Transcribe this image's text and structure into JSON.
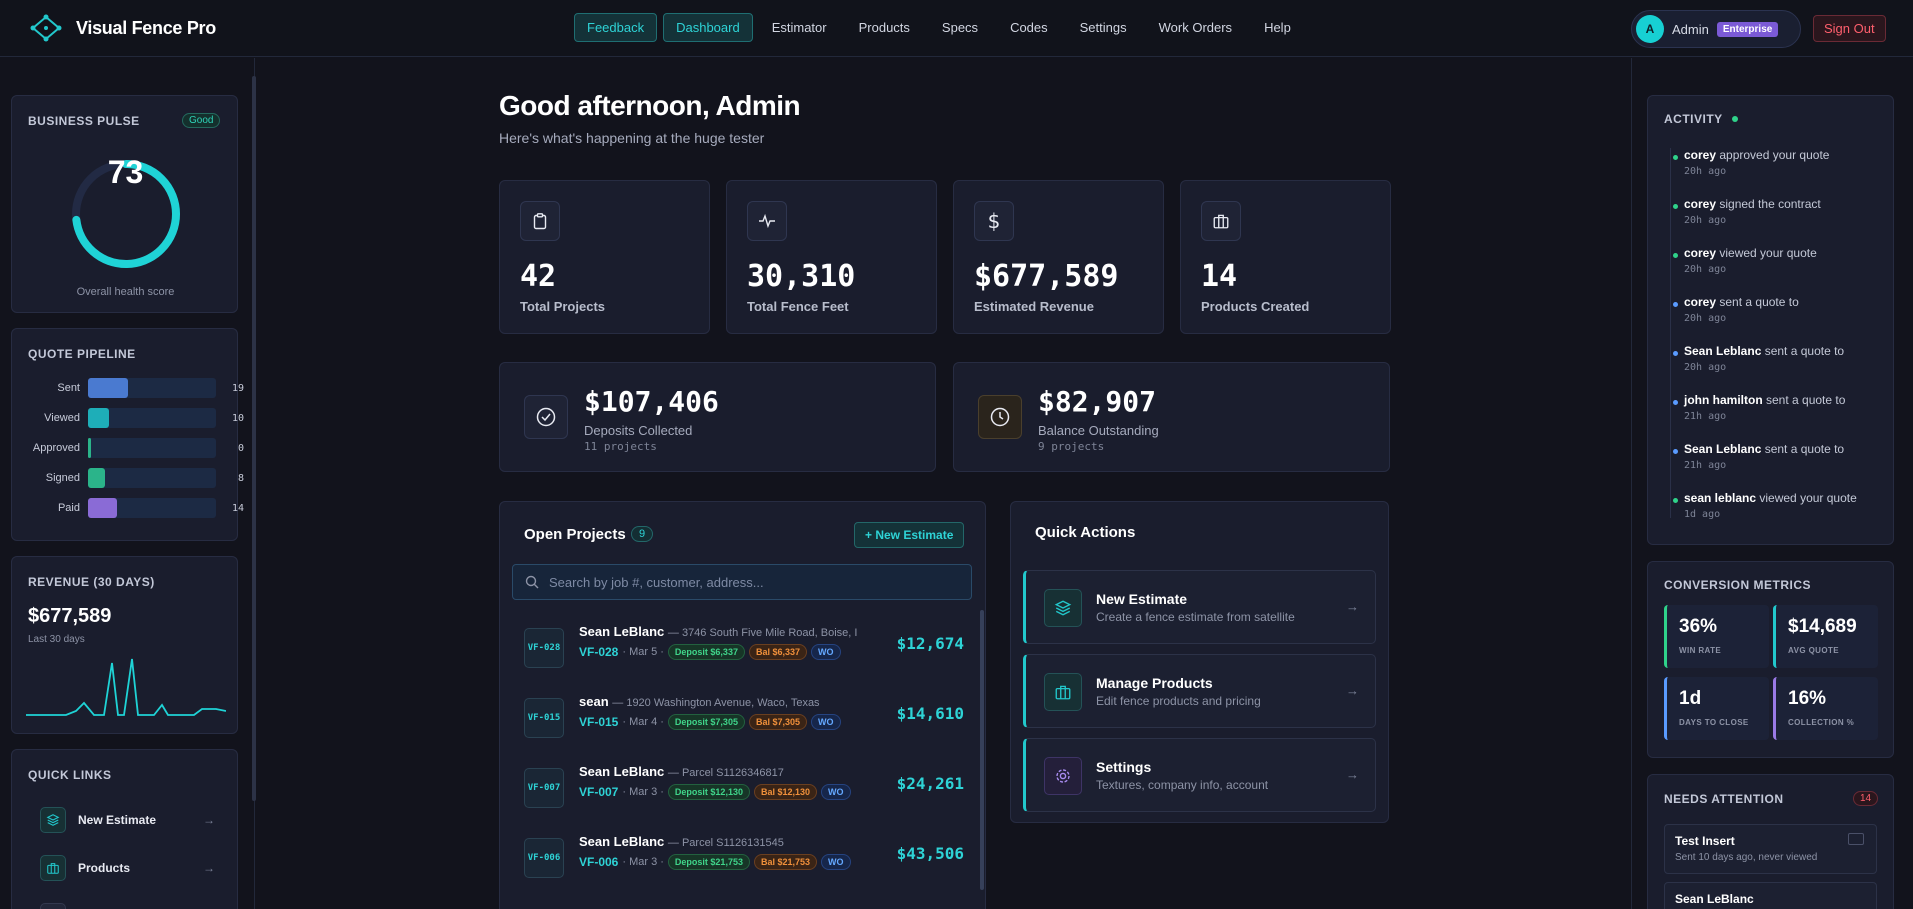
{
  "app": {
    "name": "Visual Fence Pro"
  },
  "nav": {
    "items": [
      "Feedback",
      "Dashboard",
      "Estimator",
      "Products",
      "Specs",
      "Codes",
      "Settings",
      "Work Orders",
      "Help"
    ]
  },
  "user": {
    "initial": "A",
    "name": "Admin",
    "plan": "Enterprise",
    "signout": "Sign Out"
  },
  "business_pulse": {
    "title": "BUSINESS PULSE",
    "status": "Good",
    "score": 73,
    "score_text": "73",
    "caption": "Overall health score",
    "accent": "#1fd3d6"
  },
  "pipeline": {
    "title": "QUOTE PIPELINE",
    "max": 19,
    "stages": [
      {
        "label": "Sent",
        "value": 19,
        "value_text": "19",
        "color": "#4a7ad0"
      },
      {
        "label": "Viewed",
        "value": 10,
        "value_text": "10",
        "color": "#1eaeb8"
      },
      {
        "label": "Approved",
        "value": 0,
        "value_text": "0",
        "color": "#2bb48a"
      },
      {
        "label": "Signed",
        "value": 8,
        "value_text": "8",
        "color": "#2bb48a"
      },
      {
        "label": "Paid",
        "value": 14,
        "value_text": "14",
        "color": "#8a6bd6"
      }
    ]
  },
  "revenue": {
    "title": "REVENUE (30 DAYS)",
    "amount": "$677,589",
    "caption": "Last 30 days"
  },
  "quick_links": {
    "title": "QUICK LINKS",
    "items": [
      {
        "label": "New Estimate",
        "icon": "layers-icon"
      },
      {
        "label": "Products",
        "icon": "briefcase-icon"
      }
    ]
  },
  "greeting": {
    "title": "Good afternoon, Admin",
    "subtitle": "Here's what's happening at the huge tester"
  },
  "stats": [
    {
      "value": "42",
      "label": "Total Projects",
      "icon": "clipboard-icon"
    },
    {
      "value": "30,310",
      "label": "Total Fence Feet",
      "icon": "activity-icon"
    },
    {
      "value": "$677,589",
      "label": "Estimated Revenue",
      "icon": "dollar-icon"
    },
    {
      "value": "14",
      "label": "Products Created",
      "icon": "briefcase-icon"
    }
  ],
  "money": [
    {
      "value": "$107,406",
      "label": "Deposits Collected",
      "sub": "11 projects",
      "icon": "check-circle-icon"
    },
    {
      "value": "$82,907",
      "label": "Balance Outstanding",
      "sub": "9 projects",
      "icon": "clock-icon"
    }
  ],
  "open_projects": {
    "title": "Open Projects",
    "count": "9",
    "new_button": "+ New Estimate",
    "search_placeholder": "Search by job #, customer, address...",
    "rows": [
      {
        "badge": "VF-028",
        "name": "Sean LeBlanc",
        "addr": "— 3746 South Five Mile Road, Boise, I",
        "code": "VF-028",
        "date": "· Mar 5 ·",
        "deposit": "Deposit $6,337",
        "balance": "Bal $6,337",
        "wo": "WO",
        "amount": "$12,674"
      },
      {
        "badge": "VF-015",
        "name": "sean",
        "addr": "— 1920 Washington Avenue, Waco, Texas",
        "code": "VF-015",
        "date": "· Mar 4 ·",
        "deposit": "Deposit $7,305",
        "balance": "Bal $7,305",
        "wo": "WO",
        "amount": "$14,610"
      },
      {
        "badge": "VF-007",
        "name": "Sean LeBlanc",
        "addr": "— Parcel S1126346817",
        "code": "VF-007",
        "date": "· Mar 3 ·",
        "deposit": "Deposit $12,130",
        "balance": "Bal $12,130",
        "wo": "WO",
        "amount": "$24,261"
      },
      {
        "badge": "VF-006",
        "name": "Sean LeBlanc",
        "addr": "— Parcel S1126131545",
        "code": "VF-006",
        "date": "· Mar 3 ·",
        "deposit": "Deposit $21,753",
        "balance": "Bal $21,753",
        "wo": "WO",
        "amount": "$43,506"
      }
    ]
  },
  "quick_actions": {
    "title": "Quick Actions",
    "items": [
      {
        "name": "New Estimate",
        "desc": "Create a fence estimate from satellite",
        "icon": "layers-icon"
      },
      {
        "name": "Manage Products",
        "desc": "Edit fence products and pricing",
        "icon": "briefcase-icon"
      },
      {
        "name": "Settings",
        "desc": "Textures, company info, account",
        "icon": "gear-icon"
      }
    ]
  },
  "activity": {
    "title": "ACTIVITY",
    "items": [
      {
        "who": "corey",
        "what": " approved your quote",
        "time": "20h ago",
        "color": "#2fd28a"
      },
      {
        "who": "corey",
        "what": " signed the contract",
        "time": "20h ago",
        "color": "#2fd28a"
      },
      {
        "who": "corey",
        "what": " viewed your quote",
        "time": "20h ago",
        "color": "#2fd28a"
      },
      {
        "who": "corey",
        "what": " sent a quote to",
        "time": "20h ago",
        "color": "#5a9bff"
      },
      {
        "who": "Sean Leblanc",
        "what": " sent a quote to",
        "time": "20h ago",
        "color": "#5a9bff"
      },
      {
        "who": "john hamilton",
        "what": " sent a quote to",
        "time": "21h ago",
        "color": "#5a9bff"
      },
      {
        "who": "Sean Leblanc",
        "what": " sent a quote to",
        "time": "21h ago",
        "color": "#5a9bff"
      },
      {
        "who": "sean leblanc",
        "what": " viewed your quote",
        "time": "1d ago",
        "color": "#2fd28a"
      }
    ]
  },
  "conversion": {
    "title": "CONVERSION METRICS",
    "tiles": [
      {
        "value": "36%",
        "label": "WIN RATE",
        "color": "#2fd28a"
      },
      {
        "value": "$14,689",
        "label": "AVG QUOTE",
        "color": "#22c8cc"
      },
      {
        "value": "1d",
        "label": "DAYS TO CLOSE",
        "color": "#5a9bff"
      },
      {
        "value": "16%",
        "label": "COLLECTION %",
        "color": "#9a7ae6"
      }
    ]
  },
  "needs_attention": {
    "title": "NEEDS ATTENTION",
    "count": "14",
    "items": [
      {
        "name": "Test Insert",
        "sub": "Sent 10 days ago, never viewed"
      },
      {
        "name": "Sean LeBlanc",
        "sub": ""
      }
    ]
  }
}
